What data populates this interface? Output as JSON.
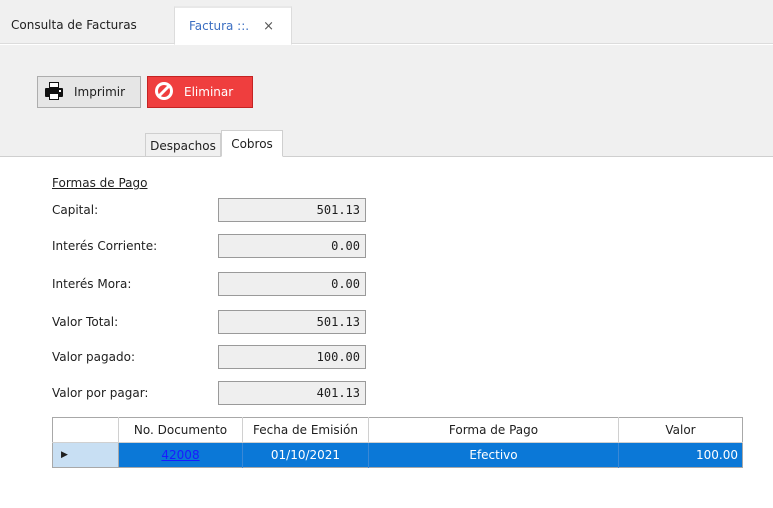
{
  "tabs": [
    {
      "label": "Consulta de Facturas",
      "active": false
    },
    {
      "label": "Factura ::.",
      "active": true,
      "close_glyph": "×"
    }
  ],
  "toolbar": {
    "print_label": "Imprimir",
    "print_icon": "printer-icon",
    "delete_label": "Eliminar",
    "delete_icon": "prohibited-icon",
    "delete_color": "#ef3e3e"
  },
  "inner_tabs": [
    {
      "label": "Despachos",
      "active": false
    },
    {
      "label": "Cobros",
      "active": true
    }
  ],
  "payment": {
    "group_title": "Formas de Pago",
    "fields": [
      {
        "label": "Capital:",
        "value": "501.13"
      },
      {
        "label": "Interés Corriente:",
        "value": "0.00"
      },
      {
        "label": "Interés Mora:",
        "value": "0.00"
      },
      {
        "label": "Valor Total:",
        "value": "501.13"
      },
      {
        "label": "Valor pagado:",
        "value": "100.00"
      },
      {
        "label": "Valor por pagar:",
        "value": "401.13"
      }
    ]
  },
  "grid": {
    "columns": [
      "No. Documento",
      "Fecha de Emisión",
      "Forma de Pago",
      "Valor"
    ],
    "rows": [
      {
        "doc": "42008",
        "fecha": "01/10/2021",
        "forma": "Efectivo",
        "valor": "100.00",
        "selected": true
      }
    ],
    "row_indicator": "▶",
    "selection_color": "#0b78d7"
  }
}
